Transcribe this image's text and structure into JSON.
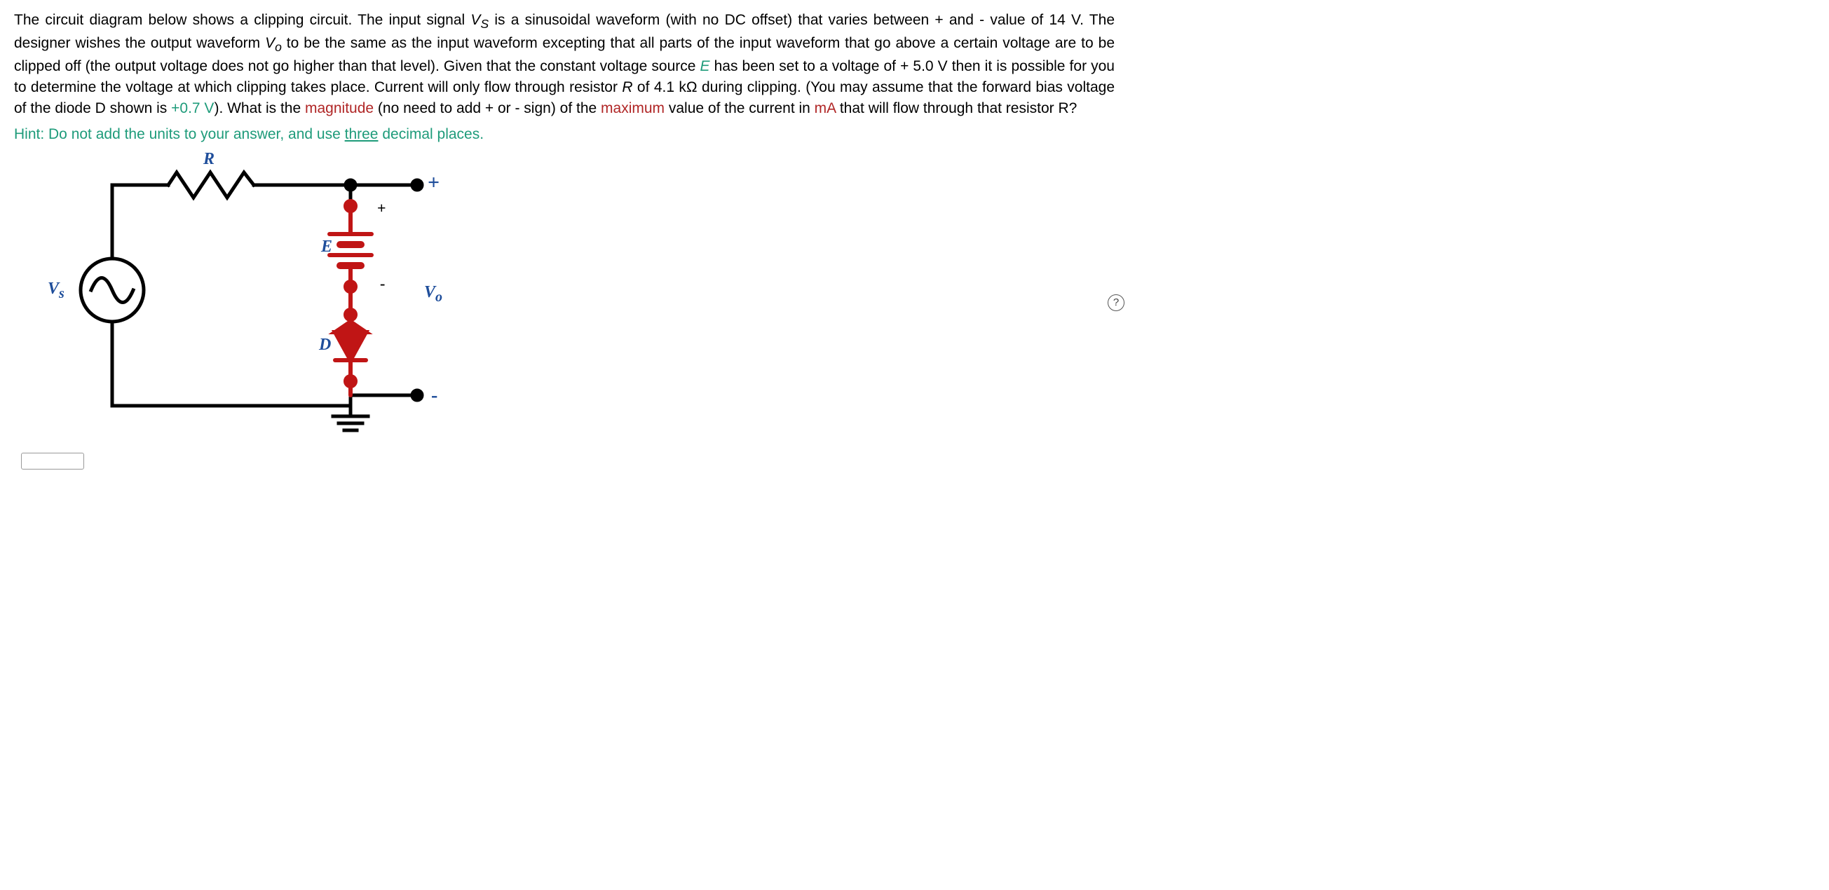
{
  "problem": {
    "s01": "The circuit diagram below shows a clipping circuit. The input signal ",
    "s02_Vs": "V",
    "s02_Vs_sub": "S",
    "s03": " is a sinusoidal waveform (with no DC offset) that varies between  + and - value of ",
    "s04_amp": "14 V",
    "s05": ". The designer wishes the output waveform ",
    "s06_Vo": "V",
    "s06_Vo_sub": "o",
    "s07": " to be the same as the input waveform excepting that all parts of the input waveform that go above a certain voltage are to be clipped off (the output voltage does not go higher than that level).  Given that the constant voltage source ",
    "s08_E": "E",
    "s09": " has been set to a voltage of ",
    "s10_Eval": "+ 5.0 V",
    "s11": " then it is possible for you to determine the voltage at which clipping takes place. Current will only flow through resistor ",
    "s12_R": "R",
    "s13": " of ",
    "s14_Rval": "4.1 kΩ",
    "s15": " during clipping. (You may assume that the forward bias voltage of the diode ",
    "s16_D": "D",
    "s17": " shown is ",
    "s18_Vd": "+0.7 V",
    "s19": "). What is the ",
    "s20_mag": "magnitude",
    "s21": " (no need to add + or - sign) of the ",
    "s22_max": "maximum",
    "s23": " value of the current in ",
    "s24_mA": "mA",
    "s25": " that will flow through that resistor R?"
  },
  "hint": {
    "pre": "Hint: Do not add the units to your answer, and use ",
    "mid": "three",
    "post": " decimal places."
  },
  "labels": {
    "R": "R",
    "E": "E",
    "D": "D",
    "Vs": "V",
    "Vs_sub": "s",
    "Vo": "V",
    "Vo_sub": "o",
    "plus": "+",
    "minus": "-",
    "small_plus": "+",
    "small_minus": "-"
  },
  "answer_placeholder": "",
  "help": "?"
}
